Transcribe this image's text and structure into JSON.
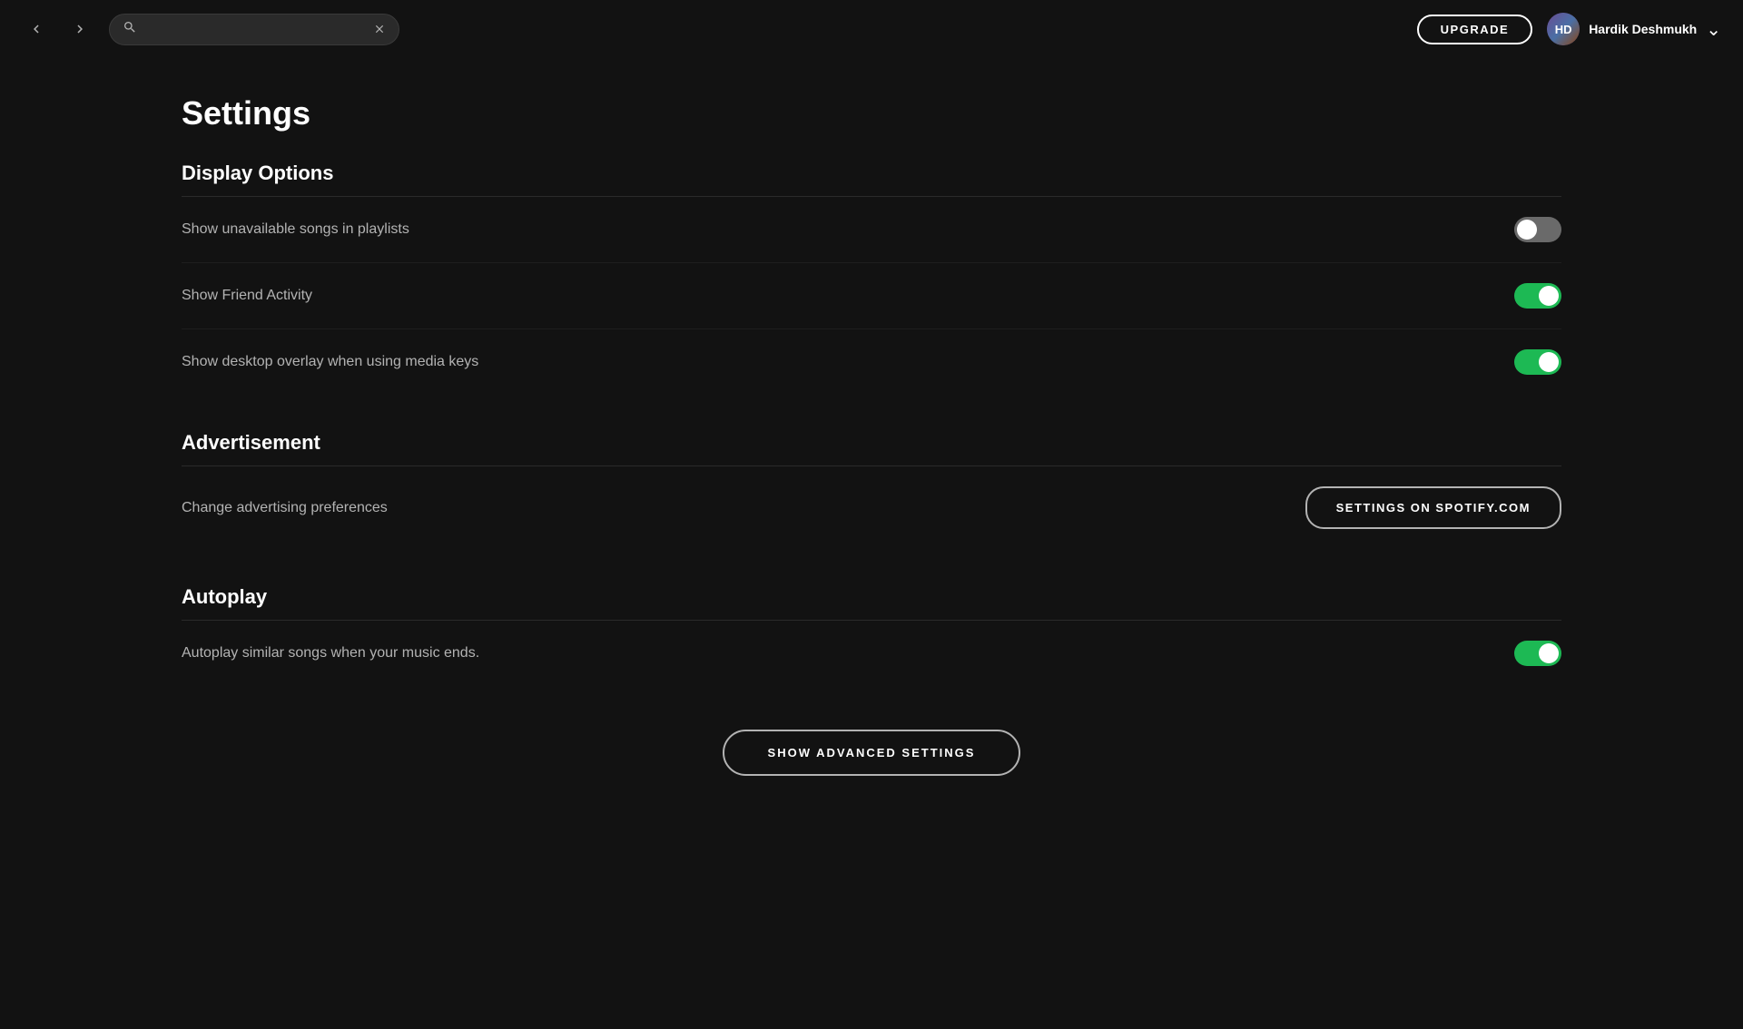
{
  "nav": {
    "search_placeholder": "",
    "upgrade_label": "UPGRADE",
    "user_name": "Hardik Deshmukh",
    "user_initials": "HD"
  },
  "page": {
    "title": "Settings"
  },
  "sections": [
    {
      "id": "display-options",
      "title": "Display Options",
      "settings": [
        {
          "id": "show-unavailable-songs",
          "label": "Show unavailable songs in playlists",
          "toggle_state": "off"
        },
        {
          "id": "show-friend-activity",
          "label": "Show Friend Activity",
          "toggle_state": "on"
        },
        {
          "id": "show-desktop-overlay",
          "label": "Show desktop overlay when using media keys",
          "toggle_state": "on"
        }
      ]
    },
    {
      "id": "advertisement",
      "title": "Advertisement",
      "settings": [
        {
          "id": "change-advertising-preferences",
          "label": "Change advertising preferences",
          "button_label": "SETTINGS ON SPOTIFY.COM"
        }
      ]
    },
    {
      "id": "autoplay",
      "title": "Autoplay",
      "settings": [
        {
          "id": "autoplay-similar-songs",
          "label": "Autoplay similar songs when your music ends.",
          "toggle_state": "on"
        }
      ]
    }
  ],
  "advanced_settings_button": "SHOW ADVANCED SETTINGS"
}
